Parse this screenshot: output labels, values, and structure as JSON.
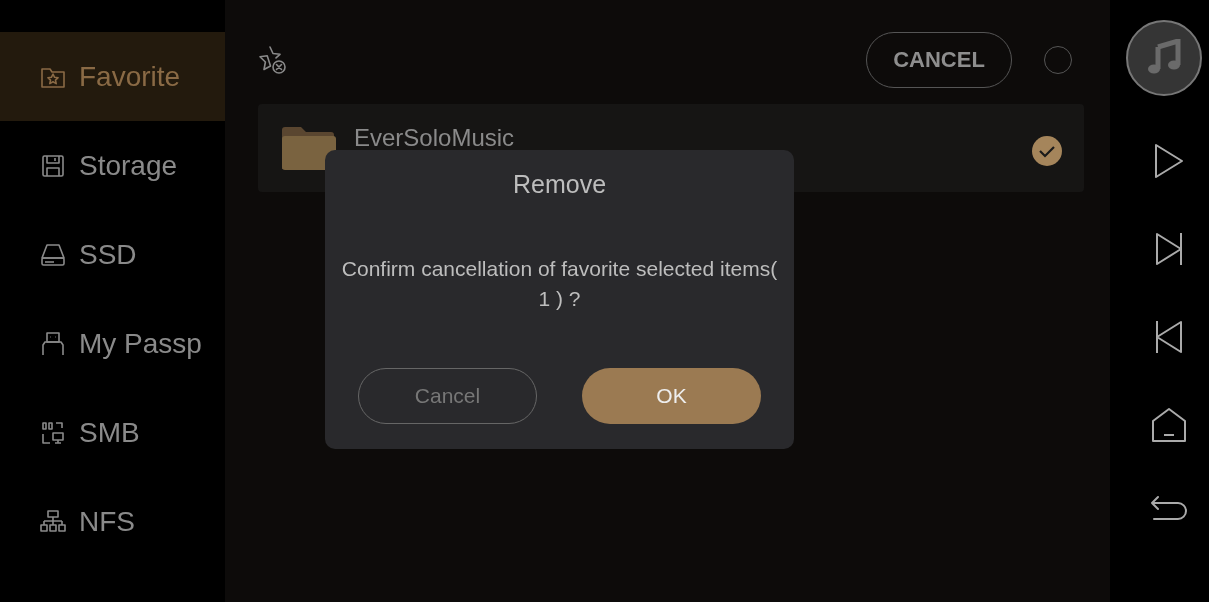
{
  "sidebar": {
    "items": [
      {
        "label": "Favorite",
        "selected": true
      },
      {
        "label": "Storage",
        "selected": false
      },
      {
        "label": "SSD",
        "selected": false
      },
      {
        "label": "My Passp",
        "selected": false
      },
      {
        "label": "SMB",
        "selected": false
      },
      {
        "label": "NFS",
        "selected": false
      }
    ]
  },
  "toolbar": {
    "cancel_button": "CANCEL",
    "select_all": {
      "checked": false
    }
  },
  "folders": [
    {
      "name": "EverSoloMusic",
      "checked": true
    }
  ],
  "dialog": {
    "title": "Remove",
    "message": "Confirm cancellation of favorite selected items( 1 ) ?",
    "buttons": [
      {
        "label": "Cancel",
        "kind": "secondary"
      },
      {
        "label": "OK",
        "kind": "primary"
      }
    ]
  }
}
